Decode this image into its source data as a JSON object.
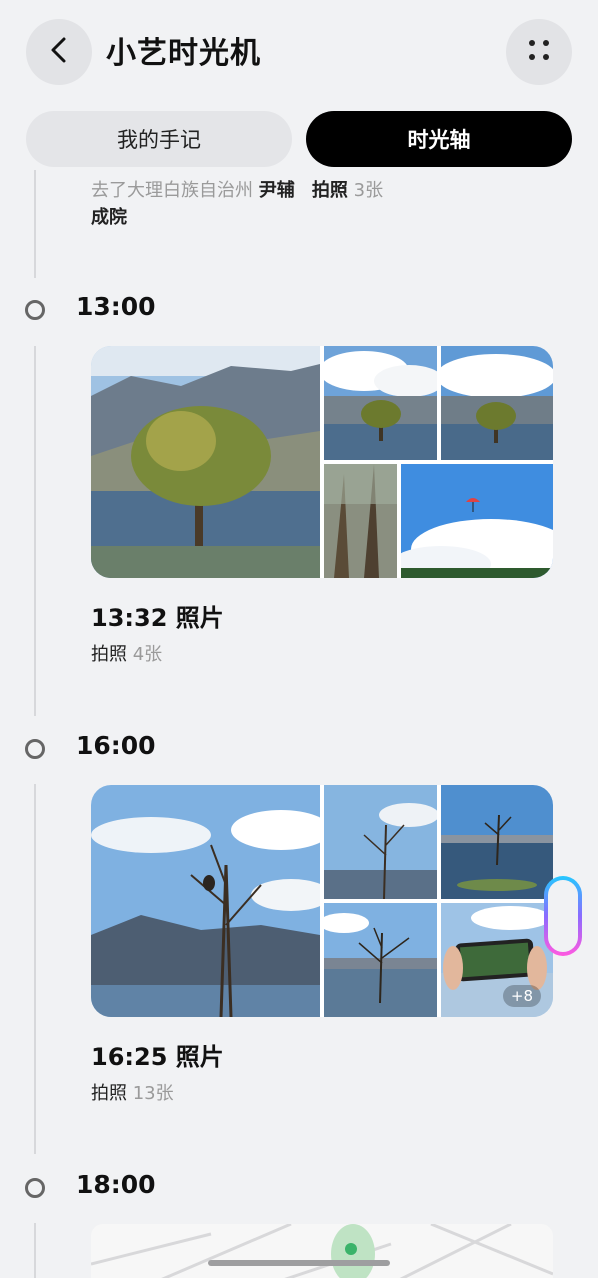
{
  "header": {
    "title": "小艺时光机",
    "back_icon": "chevron-left-icon",
    "more_icon": "grid-dots-icon"
  },
  "tabs": [
    {
      "label": "我的手记",
      "selected": false
    },
    {
      "label": "时光轴",
      "selected": true
    }
  ],
  "previous_entry": {
    "text_part1": "去了大理白族自治州 ",
    "place": "尹辅",
    "action": "拍照",
    "count": "3张",
    "text_line2": "成院"
  },
  "timeline": [
    {
      "time": "13:00",
      "card_title": "13:32 照片",
      "action": "拍照",
      "count": "4张"
    },
    {
      "time": "16:00",
      "card_title": "16:25 照片",
      "action": "拍照",
      "count": "13张",
      "more_badge": "+8"
    },
    {
      "time": "18:00"
    }
  ],
  "colors": {
    "background": "#f1f2f4",
    "selected_tab": "#000000",
    "unselected_tab": "#e4e5e8"
  }
}
